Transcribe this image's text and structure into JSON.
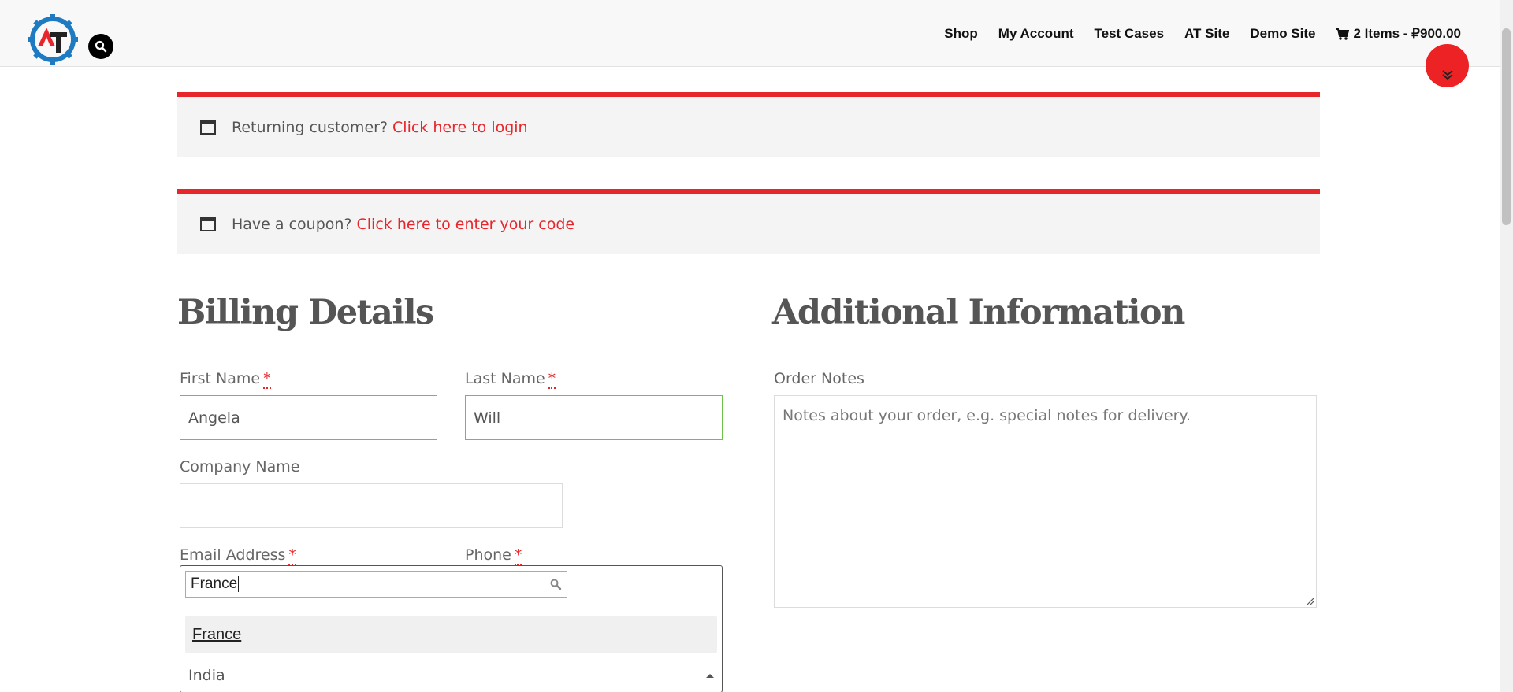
{
  "header": {
    "logo_text": "AT",
    "nav": [
      "Shop",
      "My Account",
      "Test Cases",
      "AT Site",
      "Demo Site"
    ],
    "cart_label": "2 Items - ₽900.00"
  },
  "notices": {
    "login_text": "Returning customer?",
    "login_link": "Click here to login",
    "coupon_text": "Have a coupon?",
    "coupon_link": "Click here to enter your code"
  },
  "billing": {
    "title": "Billing Details",
    "first_name_label": "First Name",
    "first_name_value": "Angela",
    "last_name_label": "Last Name",
    "last_name_value": "Will",
    "company_label": "Company Name",
    "company_value": "",
    "email_label": "Email Address",
    "phone_label": "Phone",
    "required_mark": "*",
    "country_dropdown": {
      "search_value": "France",
      "highlighted_option": "France",
      "selected_value": "India"
    }
  },
  "additional": {
    "title": "Additional Information",
    "notes_label": "Order Notes",
    "notes_placeholder": "Notes about your order, e.g. special notes for delivery."
  },
  "colors": {
    "accent": "#e7262c",
    "valid_border": "#6dc24b",
    "notice_bg": "#f4f4f4"
  }
}
